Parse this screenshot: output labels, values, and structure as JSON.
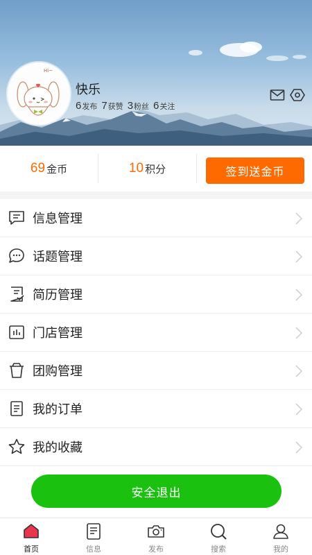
{
  "profile": {
    "name": "快乐",
    "avatar_text": "Hi~",
    "stats": [
      {
        "num": "6",
        "label": "发布"
      },
      {
        "num": "7",
        "label": "获赞"
      },
      {
        "num": "3",
        "label": "粉丝"
      },
      {
        "num": "6",
        "label": "关注"
      }
    ]
  },
  "points": {
    "coins_num": "69",
    "coins_label": "金币",
    "score_num": "10",
    "score_label": "积分",
    "signin_label": "签到送金币"
  },
  "menu": [
    {
      "label": "信息管理",
      "icon": "message-icon"
    },
    {
      "label": "话题管理",
      "icon": "chat-bubble-icon"
    },
    {
      "label": "简历管理",
      "icon": "resume-icon"
    },
    {
      "label": "门店管理",
      "icon": "store-chart-icon"
    },
    {
      "label": "团购管理",
      "icon": "cup-icon"
    },
    {
      "label": "我的订单",
      "icon": "order-list-icon"
    },
    {
      "label": "我的收藏",
      "icon": "star-icon"
    }
  ],
  "logout_label": "安全退出",
  "tabs": [
    {
      "label": "首页",
      "active": true
    },
    {
      "label": "信息"
    },
    {
      "label": "发布"
    },
    {
      "label": "搜索"
    },
    {
      "label": "我的"
    }
  ],
  "colors": {
    "accent": "#ff6a00",
    "logout": "#1ac20f",
    "tab_active": "#e8374d"
  }
}
